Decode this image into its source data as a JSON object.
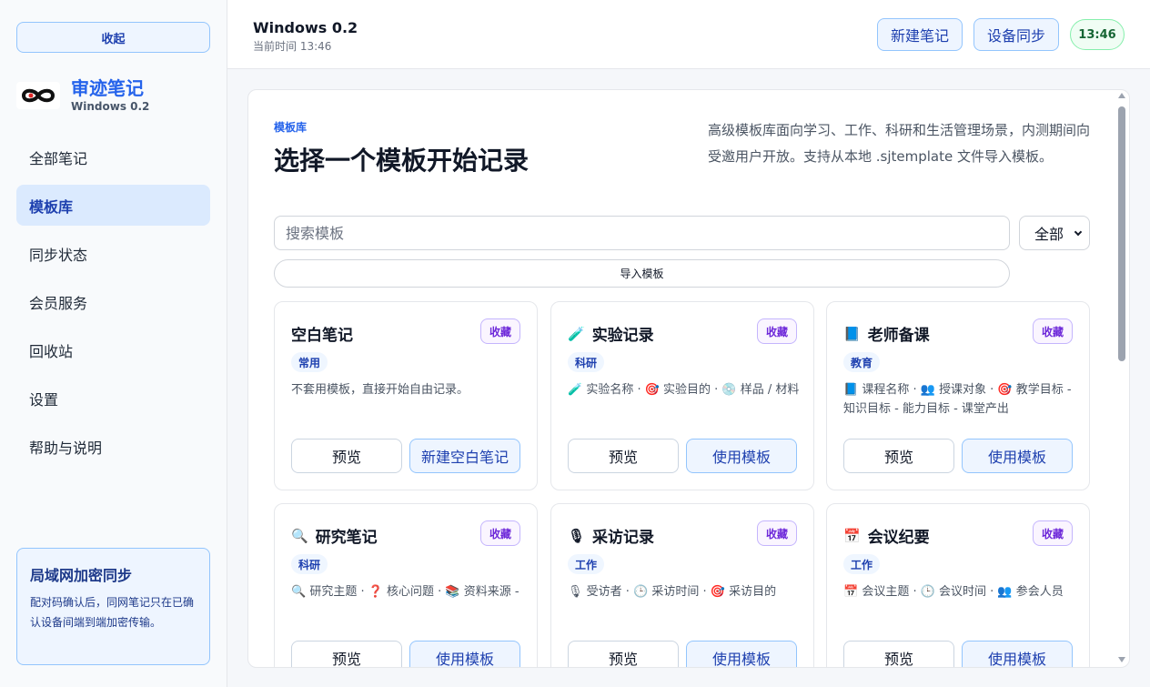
{
  "sidebar": {
    "collapse_label": "收起",
    "brand_name": "审迹笔记",
    "brand_version": "Windows 0.2",
    "nav": [
      {
        "label": "全部笔记",
        "active": false
      },
      {
        "label": "模板库",
        "active": true
      },
      {
        "label": "同步状态",
        "active": false
      },
      {
        "label": "会员服务",
        "active": false
      },
      {
        "label": "回收站",
        "active": false
      },
      {
        "label": "设置",
        "active": false
      },
      {
        "label": "帮助与说明",
        "active": false
      }
    ],
    "lan_card": {
      "title": "局域网加密同步",
      "desc": "配对码确认后，同网笔记只在已确认设备间端到端加密传输。"
    }
  },
  "header": {
    "title": "Windows 0.2",
    "time_label": "当前时间 13:46",
    "new_note_label": "新建笔记",
    "sync_label": "设备同步",
    "clock": "13:46"
  },
  "main": {
    "eyebrow": "模板库",
    "title": "选择一个模板开始记录",
    "desc": "高级模板库面向学习、工作、科研和生活管理场景，内测期间向受邀用户开放。支持从本地 .sjtemplate 文件导入模板。",
    "search_placeholder": "搜索模板",
    "filter_value": "全部",
    "import_label": "导入模板",
    "cards": [
      {
        "icon": "",
        "icon_name": "",
        "title": "空白笔记",
        "fav": "收藏",
        "tag": "常用",
        "desc": "不套用模板，直接开始自由记录。",
        "preview": "预览",
        "use": "新建空白笔记"
      },
      {
        "icon": "🧪",
        "icon_name": "test-tube-icon",
        "title": "实验记录",
        "fav": "收藏",
        "tag": "科研",
        "desc": "🧪 实验名称 · 🎯 实验目的 · 💿 样品 / 材料",
        "preview": "预览",
        "use": "使用模板"
      },
      {
        "icon": "📘",
        "icon_name": "book-icon",
        "title": "老师备课",
        "fav": "收藏",
        "tag": "教育",
        "desc": "📘 课程名称 · 👥 授课对象 · 🎯 教学目标 - 知识目标 - 能力目标 - 课堂产出",
        "preview": "预览",
        "use": "使用模板"
      },
      {
        "icon": "🔍",
        "icon_name": "magnifier-icon",
        "title": "研究笔记",
        "fav": "收藏",
        "tag": "科研",
        "desc": "🔍 研究主题 · ❓ 核心问题 · 📚 资料来源 -",
        "preview": "预览",
        "use": "使用模板"
      },
      {
        "icon": "🎙",
        "icon_name": "microphone-icon",
        "title": "采访记录",
        "fav": "收藏",
        "tag": "工作",
        "desc": "🎙 受访者 · 🕒 采访时间 · 🎯 采访目的",
        "preview": "预览",
        "use": "使用模板"
      },
      {
        "icon": "📅",
        "icon_name": "calendar-icon",
        "title": "会议纪要",
        "fav": "收藏",
        "tag": "工作",
        "desc": "📅 会议主题 · 🕒 会议时间 · 👥 参会人员",
        "preview": "预览",
        "use": "使用模板"
      }
    ]
  }
}
